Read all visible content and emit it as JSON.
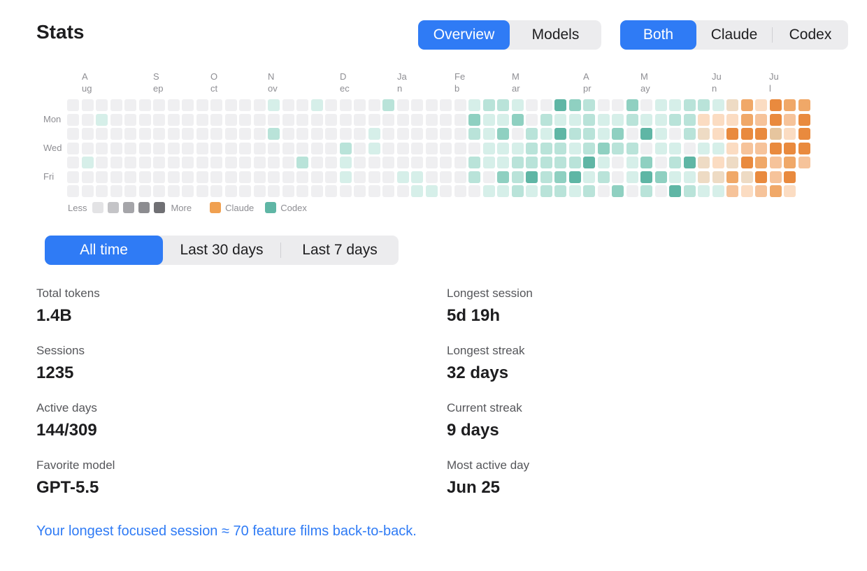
{
  "page": {
    "title": "Stats"
  },
  "view_toggle": {
    "options": [
      "Overview",
      "Models"
    ],
    "selected": "Overview"
  },
  "source_toggle": {
    "options": [
      "Both",
      "Claude",
      "Codex"
    ],
    "selected": "Both"
  },
  "heatmap": {
    "months": [
      "A\nug",
      "S\nep",
      "O\nct",
      "N\nov",
      "D\nec",
      "Ja\nn",
      "Fe\nb",
      "M\nar",
      "A\npr",
      "M\nay",
      "Ju\nn",
      "Ju\nl"
    ],
    "day_labels": [
      "Mon",
      "Wed",
      "Fri"
    ],
    "legend": {
      "less": "Less",
      "more": "More",
      "claude": "Claude",
      "codex": "Codex"
    },
    "colors": {
      "empty": "#efeff1",
      "codex_levels": [
        "#d6efe9",
        "#b9e3d9",
        "#8fd0c1",
        "#5fb6a5"
      ],
      "claude_levels": [
        "#fbdcc2",
        "#f6c39a",
        "#f0a868",
        "#e98a3e"
      ],
      "mixed_levels": [
        "#eedbc4",
        "#e6c59e"
      ],
      "grey_scale": [
        "#e3e3e5",
        "#c4c4c7",
        "#a5a5a9",
        "#8c8c90",
        "#707074"
      ],
      "claude": "#f0a050",
      "codex": "#5fb6a5"
    }
  },
  "range_toggle": {
    "options": [
      "All time",
      "Last 30 days",
      "Last 7 days"
    ],
    "selected": "All time"
  },
  "stats": {
    "left": [
      {
        "label": "Total tokens",
        "value": "1.4B"
      },
      {
        "label": "Sessions",
        "value": "1235"
      },
      {
        "label": "Active days",
        "value": "144/309"
      },
      {
        "label": "Favorite model",
        "value": "GPT-5.5"
      }
    ],
    "right": [
      {
        "label": "Longest session",
        "value": "5d 19h"
      },
      {
        "label": "Longest streak",
        "value": "32 days"
      },
      {
        "label": "Current streak",
        "value": "9 days"
      },
      {
        "label": "Most active day",
        "value": "Jun 25"
      }
    ]
  },
  "footer": {
    "text": "Your longest focused session ≈ 70 feature films back-to-back."
  }
}
